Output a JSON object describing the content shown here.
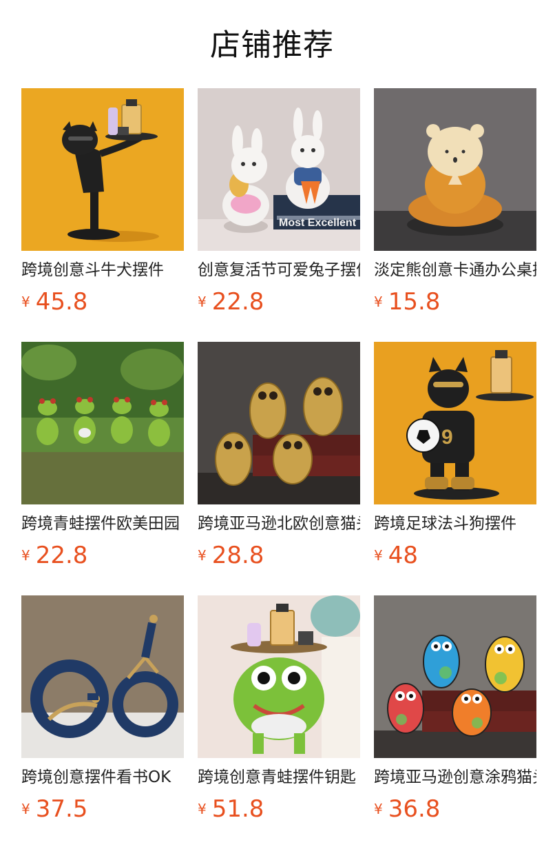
{
  "header": {
    "title": "店铺推荐"
  },
  "products": [
    {
      "name": "跨境创意斗牛犬摆件",
      "currency": "¥",
      "price": "45.8",
      "image_icon": "bulldog-tray-figurine-icon",
      "bg": "#e8a21e"
    },
    {
      "name": "创意复活节可爱兔子摆件",
      "currency": "¥",
      "price": "22.8",
      "image_icon": "easter-bunny-figurine-icon",
      "bg": "#d8cfcd"
    },
    {
      "name": "淡定熊创意卡通办公桌摆件",
      "currency": "¥",
      "price": "15.8",
      "image_icon": "meditating-bear-figurine-icon",
      "bg": "#6f6b6c"
    },
    {
      "name": "跨境青蛙摆件欧美田园",
      "currency": "¥",
      "price": "22.8",
      "image_icon": "frog-band-figurine-icon",
      "bg": "#5f8a3a"
    },
    {
      "name": "跨境亚马逊北欧创意猫头鹰",
      "currency": "¥",
      "price": "28.8",
      "image_icon": "golden-owl-figurine-icon",
      "bg": "#4a4644"
    },
    {
      "name": "跨境足球法斗狗摆件",
      "currency": "¥",
      "price": "48",
      "image_icon": "football-bulldog-figurine-icon",
      "bg": "#e9a020"
    },
    {
      "name": "跨境创意摆件看书OK",
      "currency": "¥",
      "price": "37.5",
      "image_icon": "reading-figure-ring-icon",
      "bg": "#8c7c68"
    },
    {
      "name": "跨境创意青蛙摆件钥匙",
      "currency": "¥",
      "price": "51.8",
      "image_icon": "frog-tray-figurine-icon",
      "bg": "#efe3dd"
    },
    {
      "name": "跨境亚马逊创意涂鸦猫头鹰",
      "currency": "¥",
      "price": "36.8",
      "image_icon": "graffiti-owl-figurine-icon",
      "bg": "#7a7672"
    }
  ]
}
